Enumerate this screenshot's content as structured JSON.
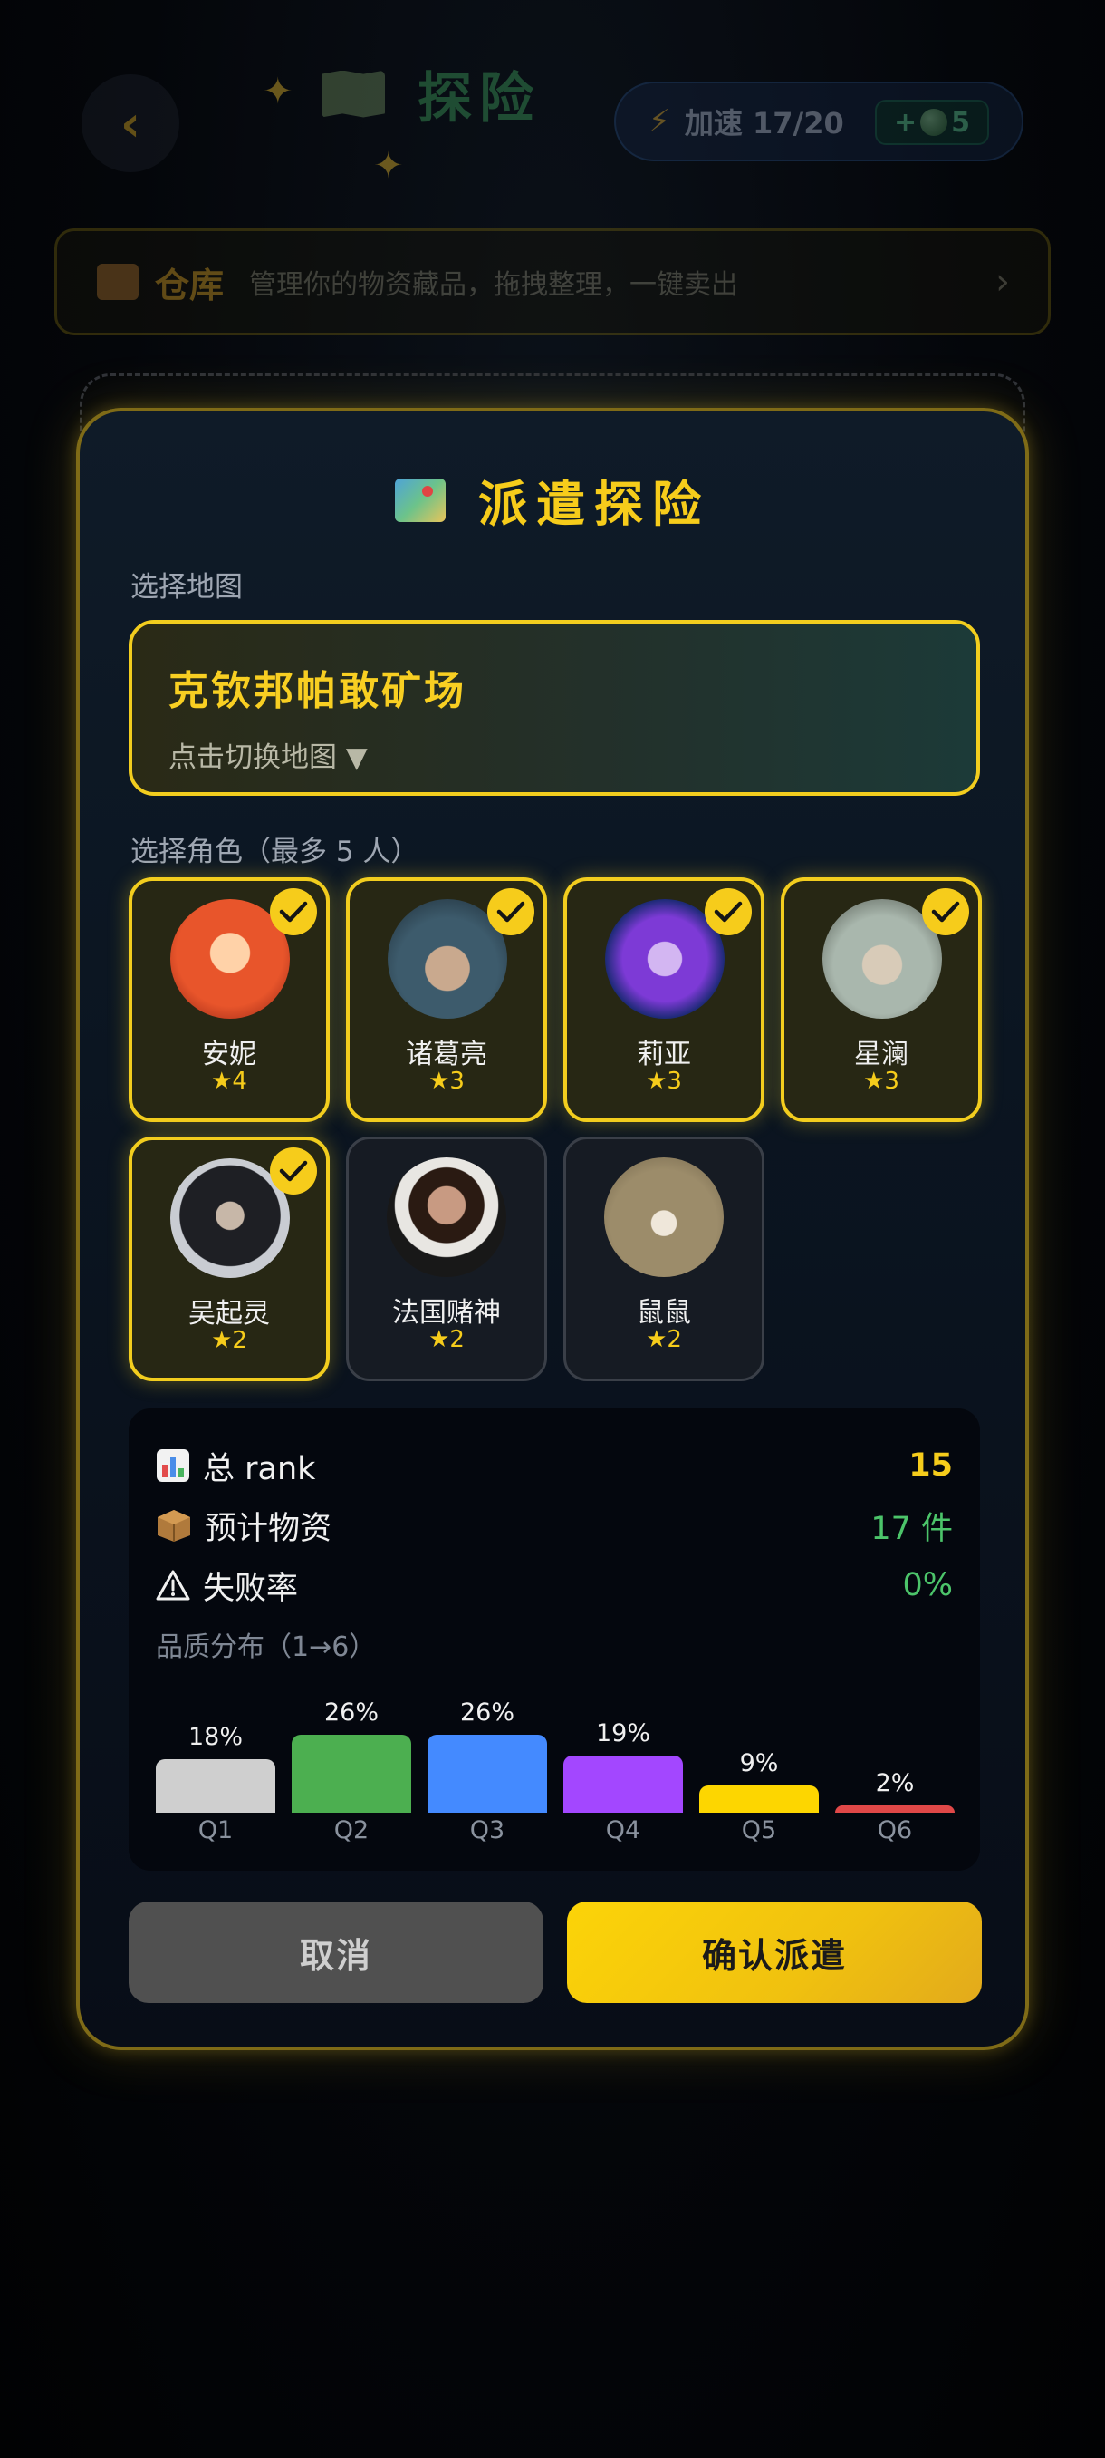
{
  "header": {
    "back_label": "‹",
    "title": "探险",
    "speed_label": "加速 17/20",
    "boost_prefix": "+",
    "boost_count": "5"
  },
  "warehouse": {
    "title": "仓库",
    "description": "管理你的物资藏品，拖拽整理，一键卖出",
    "chevron": "›"
  },
  "modal": {
    "title": "派遣探险",
    "map_section_label": "选择地图",
    "map_name": "克钦邦帕敢矿场",
    "map_hint": "点击切换地图 ▼",
    "role_section_label": "选择角色（最多 5 人）",
    "roles": [
      {
        "name": "安妮",
        "stars": "★4",
        "selected": true
      },
      {
        "name": "诸葛亮",
        "stars": "★3",
        "selected": true
      },
      {
        "name": "莉亚",
        "stars": "★3",
        "selected": true
      },
      {
        "name": "星澜",
        "stars": "★3",
        "selected": true
      },
      {
        "name": "吴起灵",
        "stars": "★2",
        "selected": true
      },
      {
        "name": "法国赌神",
        "stars": "★2",
        "selected": false
      },
      {
        "name": "鼠鼠",
        "stars": "★2",
        "selected": false
      }
    ],
    "stats": {
      "rank_label": "总 rank",
      "rank_value": "15",
      "supplies_label": "预计物资",
      "supplies_value": "17 件",
      "fail_label": "失败率",
      "fail_value": "0%",
      "distribution_label": "品质分布（1→6）"
    },
    "cancel_label": "取消",
    "confirm_label": "确认派遣"
  },
  "colors": {
    "accent": "#f6cc1b",
    "success": "#4cc46a"
  },
  "chart_data": {
    "type": "bar",
    "categories": [
      "Q1",
      "Q2",
      "Q3",
      "Q4",
      "Q5",
      "Q6"
    ],
    "values": [
      18,
      26,
      26,
      19,
      9,
      2
    ],
    "value_labels": [
      "18%",
      "26%",
      "26%",
      "19%",
      "9%",
      "2%"
    ],
    "colors": [
      "#cfcfcf",
      "#4caf50",
      "#448aff",
      "#a347ff",
      "#fdd600",
      "#e04848"
    ],
    "title": "品质分布（1→6）",
    "xlabel": "",
    "ylabel": ""
  }
}
